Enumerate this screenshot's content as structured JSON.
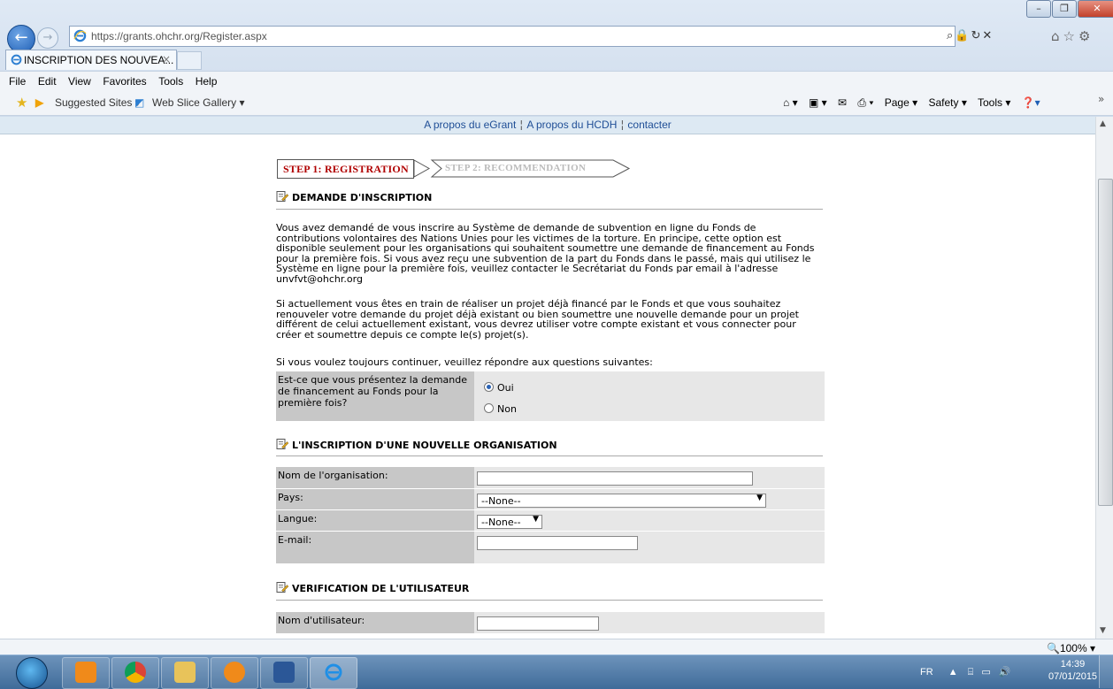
{
  "browser": {
    "url": "https://grants.ohchr.org/Register.aspx",
    "tab_title": "INSCRIPTION DES NOUVEA...",
    "tab_close": "×",
    "menu": [
      "File",
      "Edit",
      "View",
      "Favorites",
      "Tools",
      "Help"
    ],
    "favorites": {
      "suggested": "Suggested Sites ▾",
      "webslice": "Web Slice Gallery ▾"
    },
    "command_bar": [
      "Page ▾",
      "Safety ▾",
      "Tools ▾"
    ],
    "zoom": "100%"
  },
  "nav": {
    "about_egrant": "A propos du eGrant",
    "about_hcdh": "A propos du HCDH",
    "contact": "contacter",
    "sep": "¦"
  },
  "steps": {
    "step1": "STEP 1: REGISTRATION",
    "step2": "STEP 2: RECOMMENDATION"
  },
  "sections": {
    "demande": "DEMANDE D'INSCRIPTION",
    "organisation": "L'INSCRIPTION D'UNE NOUVELLE ORGANISATION",
    "verification": "VERIFICATION DE L'UTILISATEUR"
  },
  "intro": {
    "p1_lines": [
      "Vous avez demandé de vous inscrire au Système de demande de subvention en ligne du Fonds de",
      "contributions volontaires des Nations Unies pour les victimes de la torture. En principe, cette option est",
      "disponible seulement pour les organisations qui souhaitent soumettre une demande de financement au Fonds",
      "pour la première fois. Si vous avez reçu une subvention de la part du Fonds dans le passé, mais qui utilisez le",
      "Système en ligne pour la première fois, veuillez contacter le Secrétariat du Fonds par email à l'adresse",
      "unvfvt@ohchr.org"
    ],
    "p2_lines": [
      "Si actuellement vous êtes en train de réaliser un projet déjà financé par le Fonds et que vous souhaitez",
      "renouveler votre demande du projet déjà existant ou bien soumettre une nouvelle demande pour un projet",
      "différent de celui actuellement existant, vous devrez utiliser votre compte existant et vous connecter pour",
      "créer et soumettre depuis ce compte le(s) projet(s)."
    ],
    "p3": "Si vous voulez toujours continuer, veuillez répondre aux questions suivantes:"
  },
  "question": {
    "label_lines": [
      "Est-ce que vous présentez la demande",
      "de financement au Fonds pour la",
      "première fois?"
    ],
    "options": [
      "Oui",
      "Non"
    ],
    "selected": "Oui"
  },
  "org_form": {
    "nom_label": "Nom de l'organisation:",
    "nom_value": "",
    "pays_label": "Pays:",
    "pays_value": "--None--",
    "langue_label": "Langue:",
    "langue_value": "--None--",
    "email_label": "E-mail:",
    "email_value": ""
  },
  "user_form": {
    "username_label": "Nom d'utilisateur:",
    "username_value": ""
  },
  "taskbar": {
    "lang": "FR",
    "time": "14:39",
    "date": "07/01/2015"
  }
}
